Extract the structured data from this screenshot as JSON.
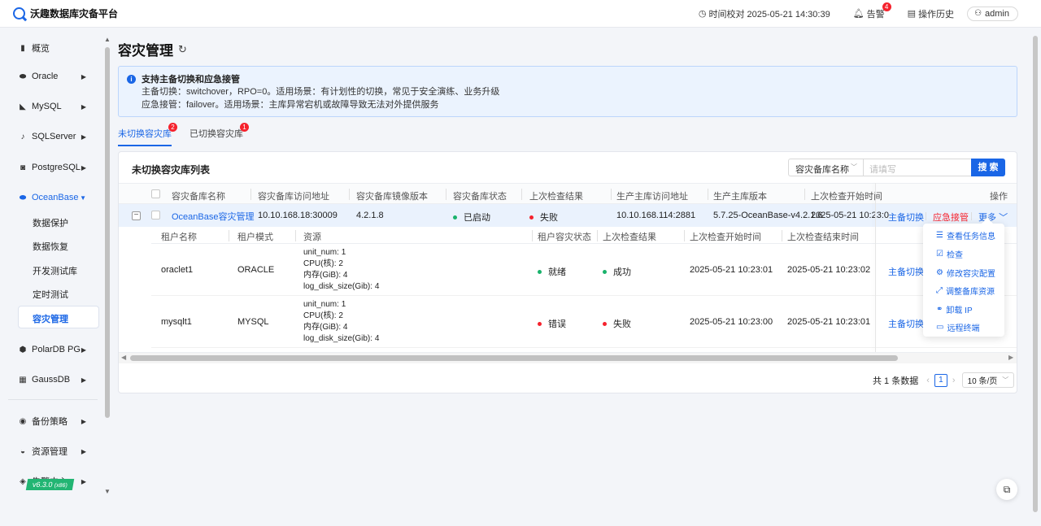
{
  "app": {
    "title": "沃趣数据库灾备平台"
  },
  "header": {
    "time_check": "时间校对 2025-05-21 14:30:39",
    "alarm_label": "告警",
    "alarm_count": "4",
    "history_label": "操作历史",
    "user": "admin"
  },
  "sidebar": {
    "items": [
      {
        "label": "概览",
        "icon": "bar-chart-icon"
      },
      {
        "label": "Oracle",
        "icon": "database-icon"
      },
      {
        "label": "MySQL",
        "icon": "dolphin-icon"
      },
      {
        "label": "SQLServer",
        "icon": "sqlserver-icon"
      },
      {
        "label": "PostgreSQL",
        "icon": "elephant-icon"
      },
      {
        "label": "OceanBase",
        "icon": "ocean-icon"
      },
      {
        "label": "PolarDB PG",
        "icon": "polardb-icon"
      },
      {
        "label": "GaussDB",
        "icon": "gauss-icon"
      },
      {
        "label": "备份策略",
        "icon": "backup-icon"
      },
      {
        "label": "资源管理",
        "icon": "resource-icon"
      },
      {
        "label": "告警中心",
        "icon": "alarm-icon"
      }
    ],
    "oceanbase_children": [
      "数据保护",
      "数据恢复",
      "开发测试库",
      "定时测试",
      "容灾管理"
    ],
    "version": "v6.3.0",
    "version_arch": "(x86)"
  },
  "page": {
    "title": "容灾管理",
    "info": {
      "title": "支持主备切换和应急接管",
      "line1": "主备切换：switchover，RPO=0。适用场景：有计划性的切换，常见于安全演练、业务升级",
      "line2": "应急接管：failover。适用场景：主库异常宕机或故障导致无法对外提供服务"
    },
    "tabs": [
      {
        "label": "未切换容灾库",
        "badge": "2"
      },
      {
        "label": "已切换容灾库",
        "badge": "1"
      }
    ]
  },
  "list": {
    "title": "未切换容灾库列表",
    "search_field": "容灾备库名称",
    "search_placeholder": "请填写",
    "search_button": "搜 索",
    "columns": [
      "容灾备库名称",
      "容灾备库访问地址",
      "容灾备库镜像版本",
      "容灾备库状态",
      "上次检查结果",
      "生产主库访问地址",
      "生产主库版本",
      "上次检查开始时间",
      "操作"
    ],
    "row": {
      "name": "OceanBase容灾管理",
      "address": "10.10.168.18:30009",
      "image_version": "4.2.1.8",
      "status": "已启动",
      "check_result": "失败",
      "prod_address": "10.10.168.114:2881",
      "prod_version": "5.7.25-OceanBase-v4.2.1.6",
      "check_start": "2025-05-21 10:23:0",
      "action_switch": "主备切换",
      "action_failover": "应急接管",
      "action_more": "更多"
    },
    "sub_columns": [
      "租户名称",
      "租户模式",
      "资源",
      "租户容灾状态",
      "上次检查结果",
      "上次检查开始时间",
      "上次检查结束时间"
    ],
    "tenants": [
      {
        "name": "oraclet1",
        "mode": "ORACLE",
        "res1": "unit_num: 1",
        "res2": "CPU(核): 2",
        "res3": "内存(GiB): 4",
        "res4": "log_disk_size(Gib): 4",
        "dr_status": "就绪",
        "check_result": "成功",
        "start": "2025-05-21 10:23:01",
        "end": "2025-05-21 10:23:02",
        "action": "主备切换"
      },
      {
        "name": "mysqlt1",
        "mode": "MYSQL",
        "res1": "unit_num: 1",
        "res2": "CPU(核): 2",
        "res3": "内存(GiB): 4",
        "res4": "log_disk_size(Gib): 4",
        "dr_status": "错误",
        "check_result": "失败",
        "start": "2025-05-21 10:23:00",
        "end": "2025-05-21 10:23:01",
        "action": "主备切换"
      }
    ],
    "pagination": {
      "total": "共 1 条数据",
      "page": "1",
      "size": "10 条/页"
    }
  },
  "more_menu": [
    {
      "label": "查看任务信息",
      "icon": "list-icon"
    },
    {
      "label": "检查",
      "icon": "check-square-icon"
    },
    {
      "label": "修改容灾配置",
      "icon": "gear-icon"
    },
    {
      "label": "调整备库资源",
      "icon": "resize-icon"
    },
    {
      "label": "卸载 IP",
      "icon": "unlink-icon"
    },
    {
      "label": "远程终端",
      "icon": "monitor-icon"
    }
  ],
  "colors": {
    "primary": "#1a66e6",
    "danger": "#f5222d",
    "success": "#19b26b"
  }
}
